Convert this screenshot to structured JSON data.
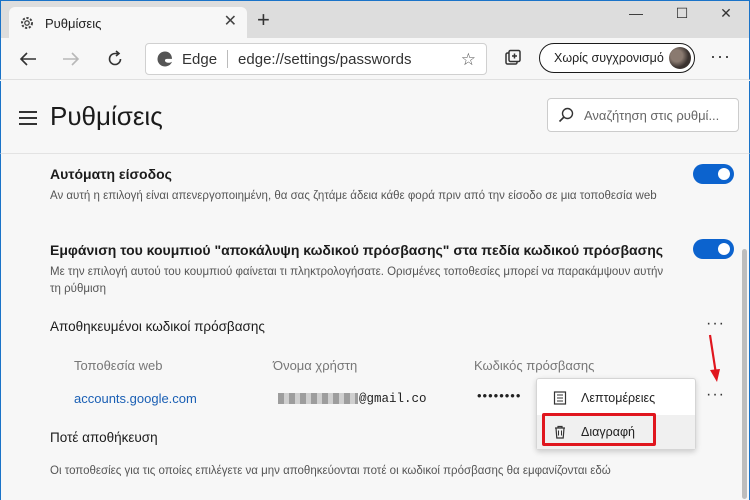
{
  "window": {
    "tab_title": "Ρυθμίσεις",
    "tab_close": "✕",
    "new_tab": "+",
    "minimize": "—",
    "maximize": "☐",
    "close": "✕"
  },
  "toolbar": {
    "browser_label": "Edge",
    "url": "edge://settings/passwords",
    "sync_label": "Χωρίς συγχρονισμό",
    "more": "···"
  },
  "header": {
    "title": "Ρυθμίσεις",
    "search_placeholder": "Αναζήτηση στις ρυθμί..."
  },
  "settings": {
    "autosignin_title": "Αυτόματη είσοδος",
    "autosignin_desc": "Αν αυτή η επιλογή είναι απενεργοποιημένη, θα σας ζητάμε άδεια κάθε φορά πριν από την είσοδο σε μια τοποθεσία web",
    "reveal_title": "Εμφάνιση του κουμπιού \"αποκάλυψη κωδικού πρόσβασης\" στα πεδία κωδικού πρόσβασης",
    "reveal_desc": "Με την επιλογή αυτού του κουμπιού φαίνεται τι πληκτρολογήσατε. Ορισμένες τοποθεσίες μπορεί να παρακάμψουν αυτήν τη ρύθμιση",
    "saved_title": "Αποθηκευμένοι κωδικοί πρόσβασης",
    "never_title": "Ποτέ αποθήκευση",
    "never_desc": "Οι τοποθεσίες για τις οποίες επιλέγετε να μην αποθηκεύονται ποτέ οι κωδικοί πρόσβασης θα εμφανίζονται εδώ"
  },
  "table": {
    "headers": [
      "Τοποθεσία web",
      "Όνομα χρήστη",
      "Κωδικός πρόσβασης"
    ],
    "rows": [
      {
        "site": "accounts.google.com",
        "username_suffix": "@gmail.co",
        "password": "••••••••"
      }
    ]
  },
  "context_menu": {
    "details": "Λεπτομέρειες",
    "delete": "Διαγραφή"
  },
  "colors": {
    "accent": "#0c63ce",
    "highlight": "#e0161e"
  }
}
